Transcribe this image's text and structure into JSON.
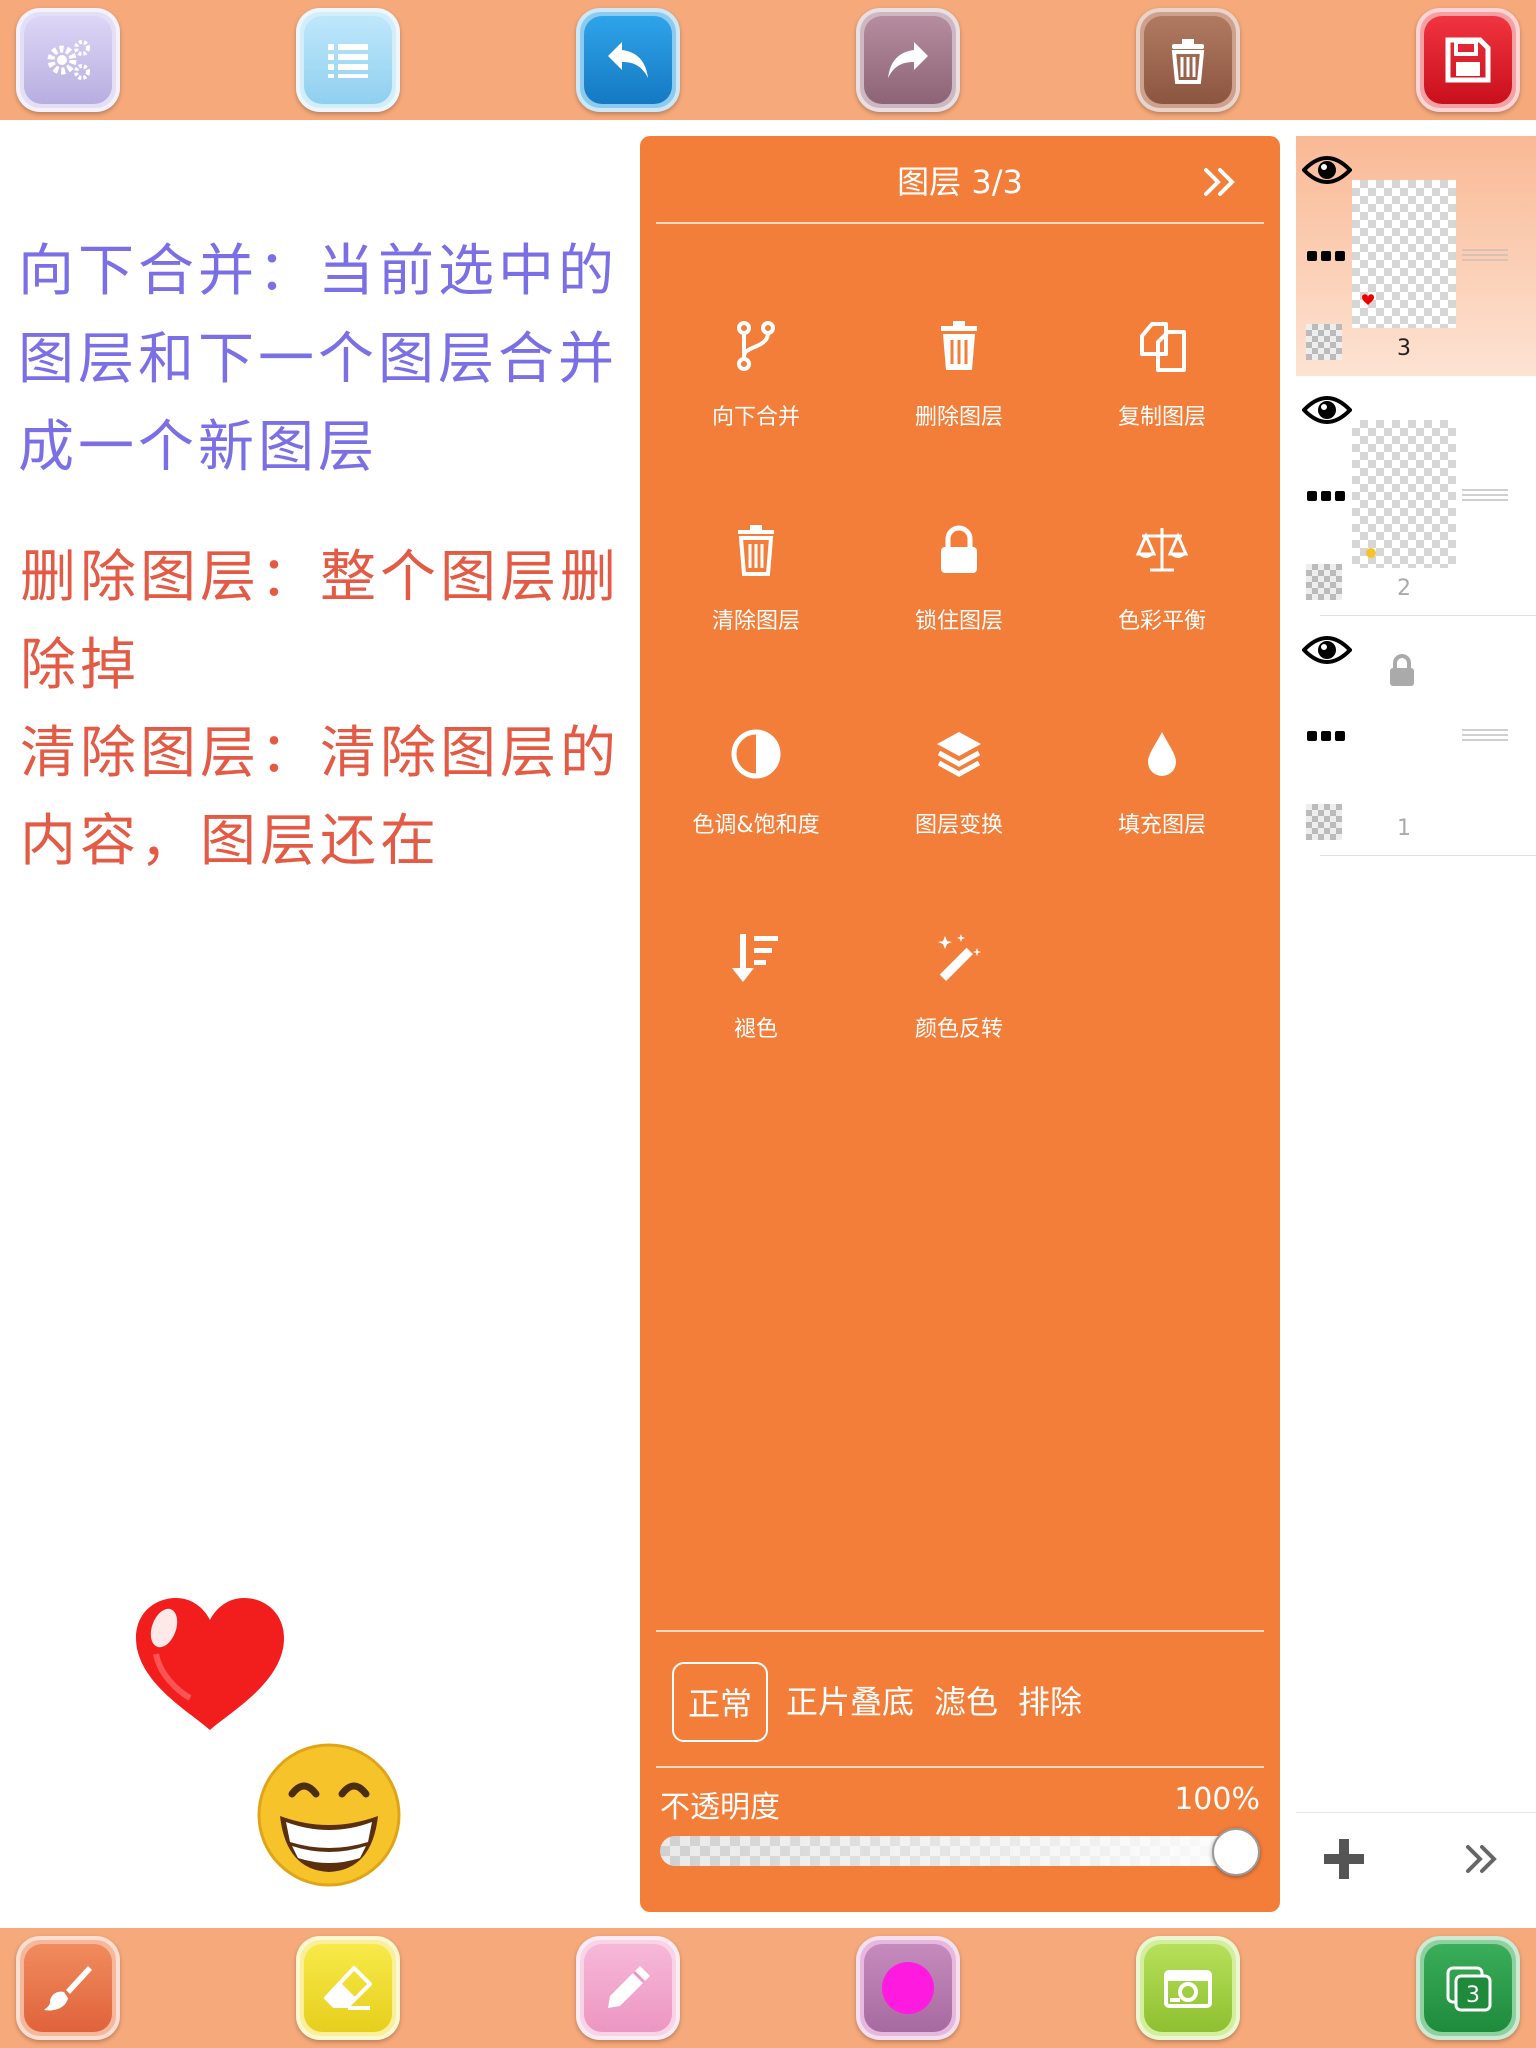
{
  "top_toolbar": {
    "buttons": [
      {
        "name": "settings-button",
        "icon": "gears-icon",
        "color": "#cfc6ef"
      },
      {
        "name": "menu-button",
        "icon": "list-icon",
        "color": "#a9ddf5"
      },
      {
        "name": "undo-button",
        "icon": "undo-icon",
        "color": "#1f8fd6"
      },
      {
        "name": "redo-button",
        "icon": "redo-icon",
        "color": "#a77f90"
      },
      {
        "name": "trash-button",
        "icon": "trash-icon",
        "color": "#a36a52"
      },
      {
        "name": "save-button",
        "icon": "floppy-icon",
        "color": "#e41f2b"
      }
    ]
  },
  "canvas": {
    "notes": {
      "merge": "向下合并：当前选中的图层和下一个图层合并成一个新图层",
      "delete": "删除图层：整个图层删除掉",
      "clear": "清除图层：清除图层的内容，图层还在"
    },
    "stickers": [
      "heart-sticker",
      "grinning-face-sticker"
    ]
  },
  "layer_panel": {
    "title": "图层 3/3",
    "actions": [
      {
        "label": "向下合并",
        "icon": "merge-down-icon"
      },
      {
        "label": "删除图层",
        "icon": "trash-icon"
      },
      {
        "label": "复制图层",
        "icon": "copy-icon"
      },
      {
        "label": "清除图层",
        "icon": "trash-icon"
      },
      {
        "label": "锁住图层",
        "icon": "lock-icon"
      },
      {
        "label": "色彩平衡",
        "icon": "balance-icon"
      },
      {
        "label": "色调&饱和度",
        "icon": "half-circle-icon"
      },
      {
        "label": "图层变换",
        "icon": "layers-icon"
      },
      {
        "label": "填充图层",
        "icon": "drop-icon"
      },
      {
        "label": "褪色",
        "icon": "sort-down-icon"
      },
      {
        "label": "颜色反转",
        "icon": "magic-wand-icon"
      }
    ],
    "blend_modes": [
      "正常",
      "正片叠底",
      "滤色",
      "排除"
    ],
    "selected_blend": "正常",
    "opacity": {
      "label": "不透明度",
      "value_text": "100%",
      "value": 1.0
    },
    "accent_color": "#f37e3a"
  },
  "layer_list": {
    "layers": [
      {
        "number": "3",
        "selected": true,
        "locked": false
      },
      {
        "number": "2",
        "selected": false,
        "locked": false
      },
      {
        "number": "1",
        "selected": false,
        "locked": true
      }
    ],
    "footer": {
      "add_icon": "plus-icon",
      "collapse_icon": "double-chevron-right-icon"
    }
  },
  "bottom_toolbar": {
    "buttons": [
      {
        "name": "brush-button",
        "icon": "brush-icon",
        "color": "#ef7a4c"
      },
      {
        "name": "eraser-button",
        "icon": "eraser-icon",
        "color": "#f4e33a"
      },
      {
        "name": "pencil-button",
        "icon": "pencil-icon",
        "color": "#f3a8cf"
      },
      {
        "name": "color-button",
        "icon": "color-swatch-icon",
        "color": "#ff1adf"
      },
      {
        "name": "camera-button",
        "icon": "camera-icon",
        "color": "#a7d84a"
      },
      {
        "name": "layers-button",
        "icon": "layers-count-icon",
        "color": "#2e9a4c",
        "badge": "3"
      }
    ]
  }
}
